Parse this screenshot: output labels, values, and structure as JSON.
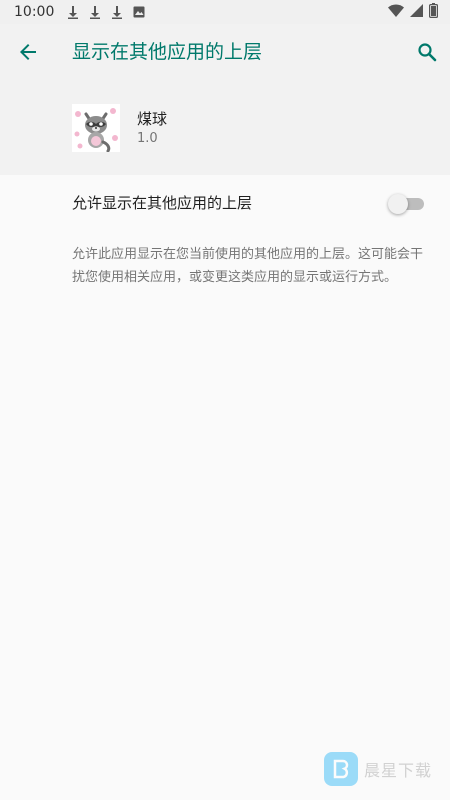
{
  "status_bar": {
    "time": "10:00",
    "notification_icons": [
      "download-icon",
      "download-icon",
      "download-icon",
      "image-icon"
    ],
    "system_icons": [
      "wifi-icon",
      "signal-icon",
      "battery-icon"
    ]
  },
  "toolbar": {
    "title": "显示在其他应用的上层",
    "back_icon": "arrow-back-icon",
    "search_icon": "search-icon",
    "accent_color": "#00796b"
  },
  "app": {
    "name": "煤球",
    "version": "1.0",
    "icon": "raccoon-app-icon"
  },
  "permission": {
    "label": "允许显示在其他应用的上层",
    "enabled": false
  },
  "description": "允许此应用显示在您当前使用的其他应用的上层。这可能会干扰您使用相关应用，或变更这类应用的显示或运行方式。",
  "watermark": {
    "text": "晨星下载"
  }
}
